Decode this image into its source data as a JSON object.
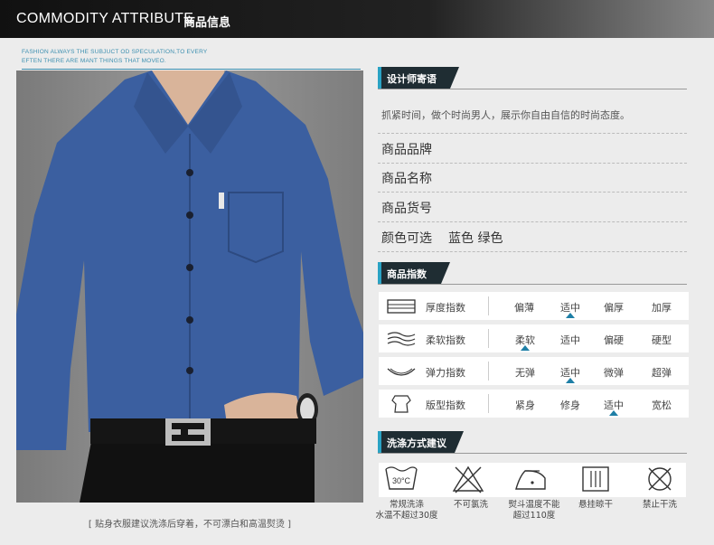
{
  "header": {
    "title": "COMMODITY ATTRIBUTE",
    "subtitle": "商品信息"
  },
  "tagline": {
    "line1": "FASHION ALWAYS THE  SUBJUCT OD SPECULATION,TO EVERY",
    "line2": "EFTEN THERE ARE MANT THINGS THAT MOVEO."
  },
  "photo_caption": "[ 贴身衣服建议洗涤后穿着，不可漂白和高温熨烫 ]",
  "designer": {
    "tag": "设计师寄语",
    "text": "抓紧时间，做个时尚男人，展示你自由自信的时尚态度。"
  },
  "info": [
    {
      "label": "商品品牌",
      "value": ""
    },
    {
      "label": "商品名称",
      "value": ""
    },
    {
      "label": "商品货号",
      "value": ""
    },
    {
      "label": "颜色可选",
      "value": "蓝色 绿色"
    }
  ],
  "index": {
    "tag": "商品指数",
    "rows": [
      {
        "icon": "thickness-icon",
        "label": "厚度指数",
        "options": [
          "偏薄",
          "适中",
          "偏厚",
          "加厚"
        ],
        "selected": 1
      },
      {
        "icon": "softness-icon",
        "label": "柔软指数",
        "options": [
          "柔软",
          "适中",
          "偏硬",
          "硬型"
        ],
        "selected": 0
      },
      {
        "icon": "elasticity-icon",
        "label": "弹力指数",
        "options": [
          "无弹",
          "适中",
          "微弹",
          "超弹"
        ],
        "selected": 1
      },
      {
        "icon": "fit-icon",
        "label": "版型指数",
        "options": [
          "紧身",
          "修身",
          "适中",
          "宽松"
        ],
        "selected": 2
      }
    ]
  },
  "wash": {
    "tag": "洗涤方式建议",
    "items": [
      {
        "icon": "wash-30-icon",
        "icon_text": "30°C",
        "label1": "常规洗涤",
        "label2": "水温不超过30度"
      },
      {
        "icon": "no-bleach-icon",
        "label1": "不可氯洗",
        "label2": ""
      },
      {
        "icon": "iron-icon",
        "label1": "熨斗温度不能",
        "label2": "超过110度"
      },
      {
        "icon": "hang-dry-icon",
        "label1": "悬挂晾干",
        "label2": ""
      },
      {
        "icon": "no-dry-clean-icon",
        "label1": "禁止干洗",
        "label2": ""
      }
    ]
  },
  "colors": {
    "accent": "#2aa3c4",
    "tag_bg": "#1f2d33",
    "shirt": "#3b5fa0",
    "marker": "#1e7fa6"
  }
}
